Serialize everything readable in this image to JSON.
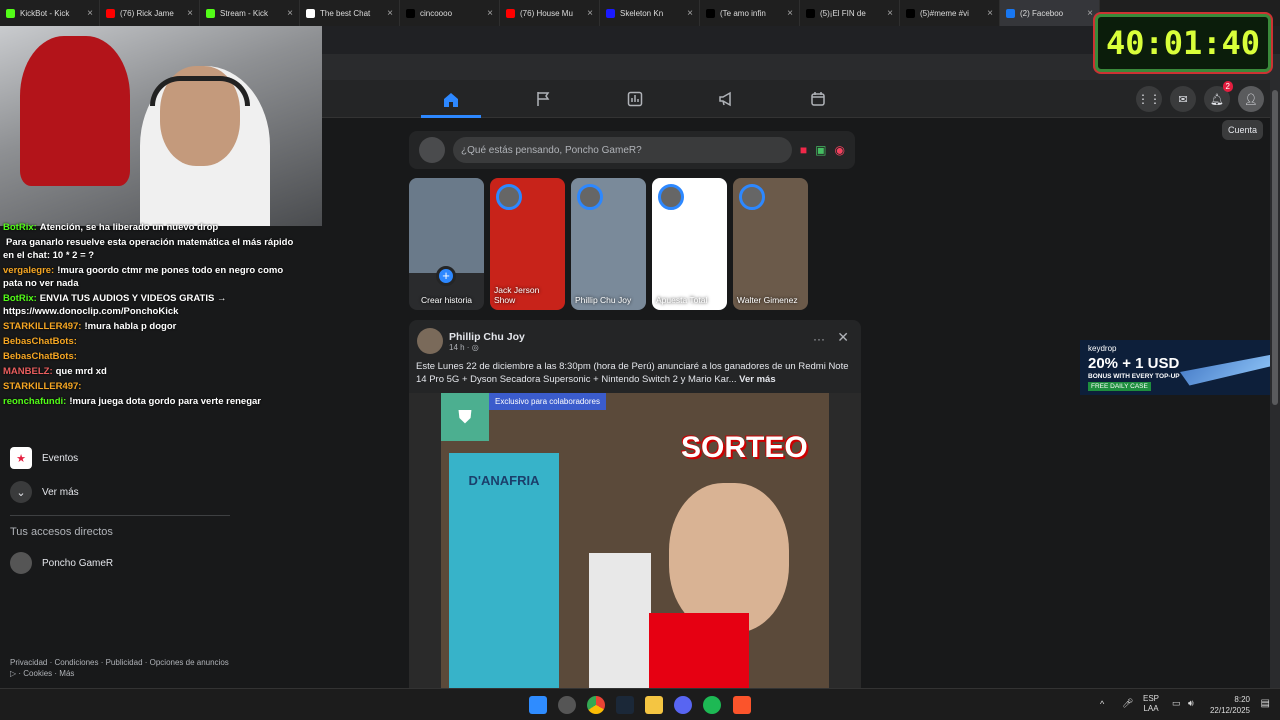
{
  "tabs": [
    {
      "title": "KickBot - Kick",
      "color": "#53fc18"
    },
    {
      "title": "(76) Rick Jame",
      "color": "#ff0000"
    },
    {
      "title": "Stream - Kick",
      "color": "#53fc18"
    },
    {
      "title": "The best Chat",
      "color": "#ffffff"
    },
    {
      "title": "cincoooo",
      "color": "#000000"
    },
    {
      "title": "(76) House Mu",
      "color": "#ff0000"
    },
    {
      "title": "Skeleton Kn",
      "color": "#1a1aff"
    },
    {
      "title": "(Te amo infin",
      "color": "#000000"
    },
    {
      "title": "(5)¡El FIN de",
      "color": "#000000"
    },
    {
      "title": "(5)#meme #vi",
      "color": "#000000"
    },
    {
      "title": "(2) Faceboo",
      "color": "#1877f2"
    }
  ],
  "timer": "40:01:40",
  "tooltip": "Cuenta",
  "notification_count": "2",
  "chat": [
    {
      "user": "BotRix:",
      "user_color": "#53fc18",
      "text": "Atención, se ha liberado un nuevo drop"
    },
    {
      "user": "",
      "user_color": "#ffffff",
      "text": "Para ganarlo resuelve esta operación matemática el más rápido en el chat: 10 * 2 = ?"
    },
    {
      "user": "vergalegre:",
      "user_color": "#f5a623",
      "text": "!mura goordo ctmr me pones todo en negro como pata no ver nada"
    },
    {
      "user": "BotRix:",
      "user_color": "#53fc18",
      "text": "ENVIA TUS AUDIOS Y VIDEOS GRATIS → https://www.donoclip.com/PonchoKick"
    },
    {
      "user": "STARKILLER497:",
      "user_color": "#f5a623",
      "text": "!mura habla p dogor"
    },
    {
      "user": "BebasChatBots:",
      "user_color": "#f5a623",
      "text": ""
    },
    {
      "user": "BebasChatBots:",
      "user_color": "#f5a623",
      "text": ""
    },
    {
      "user": "MANBELZ:",
      "user_color": "#e85d5d",
      "text": "que mrd xd"
    },
    {
      "user": "STARKILLER497:",
      "user_color": "#f5a623",
      "text": ""
    },
    {
      "user": "reonchafundi:",
      "user_color": "#53fc18",
      "text": "!mura juega dota gordo para verte renegar"
    }
  ],
  "leftnav": {
    "eventos": "Eventos",
    "ver_mas": "Ver más",
    "accesos_title": "Tus accesos directos",
    "shortcut": "Poncho GameR"
  },
  "footer": "Privacidad · Condiciones · Publicidad · Opciones de anuncios ▷ · Cookies · Más",
  "composer": {
    "placeholder": "¿Qué estás pensando, Poncho GameR?"
  },
  "stories": [
    {
      "caption": "Crear historia",
      "bg": "#2a2b2d"
    },
    {
      "caption": "Jack Jerson Show",
      "bg": "#c8231a"
    },
    {
      "caption": "Phillip Chu Joy",
      "bg": "#7a8a9a"
    },
    {
      "caption": "Apuesta Total",
      "bg": "#ffffff"
    },
    {
      "caption": "Walter Gimenez",
      "bg": "#6b5a4a"
    }
  ],
  "post": {
    "author": "Phillip Chu Joy",
    "time": "14 h · ",
    "text": "Este Lunes 22 de diciembre a las 8:30pm (hora de Perú) anunciaré a los ganadores de un Redmi Note 14 Pro 5G + Dyson Secadora Supersonic + Nintendo Switch 2 y  Mario Kar... ",
    "see_more": "Ver más",
    "exclusive": "Exclusivo para colaboradores",
    "overlay_title": "SORTEO",
    "brand": "D'ANAFRIA"
  },
  "ad": {
    "brand": "keydrop",
    "headline": "20% + 1 USD",
    "sub": "BONUS WITH EVERY TOP-UP",
    "cta": "FREE DAILY CASE"
  },
  "tray": {
    "lang1": "ESP",
    "lang2": "LAA",
    "time": "8:20",
    "date": "22/12/2025"
  }
}
